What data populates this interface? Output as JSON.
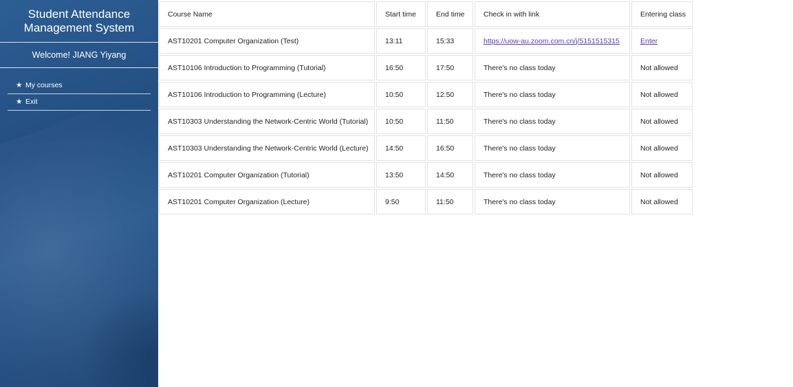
{
  "sidebar": {
    "title_line1": "Student Attendance",
    "title_line2": "Management System",
    "welcome": "Welcome! JIANG Yiyang",
    "menu": [
      {
        "icon": "star-icon",
        "star": "★",
        "label": "My courses"
      },
      {
        "icon": "star-icon",
        "star": "★",
        "label": "Exit"
      }
    ]
  },
  "table": {
    "headers": [
      "Course Name",
      "Start time",
      "End time",
      "Check in with link",
      "Entering class"
    ],
    "rows": [
      {
        "name": "AST10201 Computer Organization (Test)",
        "start": "13:11",
        "end": "15:33",
        "link": "https://uow-au.zoom.com.cn/j/5151515315",
        "enter": "Enter"
      },
      {
        "name": "AST10106 Introduction to Programming (Tutorial)",
        "start": "16:50",
        "end": "17:50",
        "link": "There's no class today",
        "enter": "Not allowed"
      },
      {
        "name": "AST10106 Introduction to Programming (Lecture)",
        "start": "10:50",
        "end": "12:50",
        "link": "There's no class today",
        "enter": "Not allowed"
      },
      {
        "name": "AST10303 Understanding the Network-Centric World (Tutorial)",
        "start": "10:50",
        "end": "11:50",
        "link": "There's no class today",
        "enter": "Not allowed"
      },
      {
        "name": "AST10303 Understanding the Network-Centric World (Lecture)",
        "start": "14:50",
        "end": "16:50",
        "link": "There's no class today",
        "enter": "Not allowed"
      },
      {
        "name": "AST10201 Computer Organization (Tutorial)",
        "start": "13:50",
        "end": "14:50",
        "link": "There's no class today",
        "enter": "Not allowed"
      },
      {
        "name": "AST10201 Computer Organization (Lecture)",
        "start": "9:50",
        "end": "11:50",
        "link": "There's no class today",
        "enter": "Not allowed"
      }
    ]
  }
}
